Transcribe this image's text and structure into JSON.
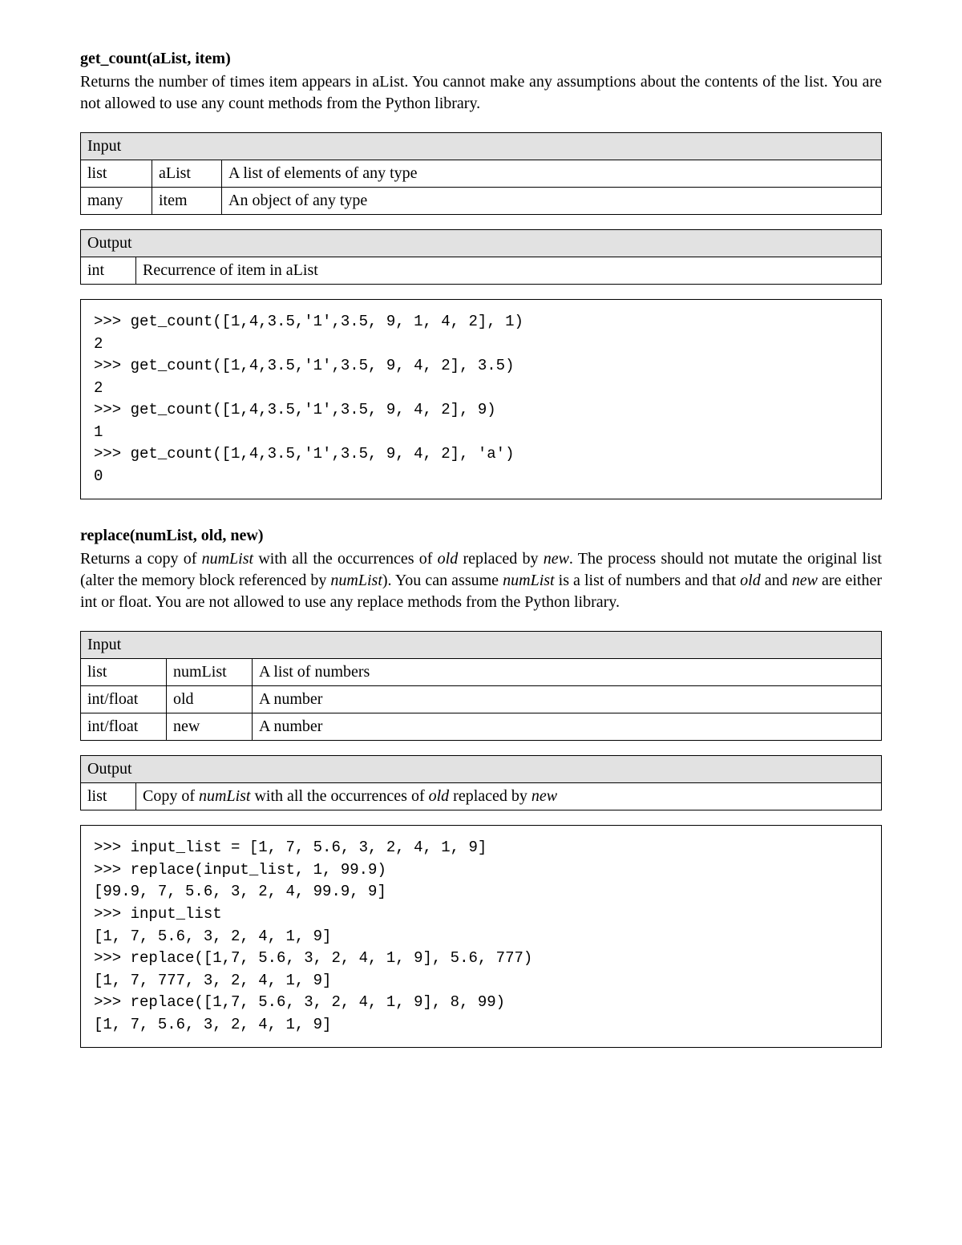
{
  "section1": {
    "heading": "get_count(aList, item)",
    "desc": "Returns the number of times item appears in aList. You cannot make any assumptions about the contents of the list. You are not allowed to use any count methods from the Python library.",
    "input_header": "Input",
    "input_rows": [
      {
        "type": "list",
        "name": "aList",
        "desc": "A list of elements of any type"
      },
      {
        "type": "many",
        "name": "item",
        "desc": "An object of any type"
      }
    ],
    "output_header": "Output",
    "output_rows": [
      {
        "type": "int",
        "desc": "Recurrence of item in aList"
      }
    ],
    "code": ">>> get_count([1,4,3.5,'1',3.5, 9, 1, 4, 2], 1)\n2\n>>> get_count([1,4,3.5,'1',3.5, 9, 4, 2], 3.5)\n2\n>>> get_count([1,4,3.5,'1',3.5, 9, 4, 2], 9)\n1\n>>> get_count([1,4,3.5,'1',3.5, 9, 4, 2], 'a')\n0"
  },
  "section2": {
    "heading": "replace(numList, old, new)",
    "desc_pre": "Returns a copy of ",
    "desc_numList": "numList",
    "desc_mid1": " with all the occurrences of ",
    "desc_old": "old",
    "desc_mid2": " replaced by ",
    "desc_new": "new",
    "desc_mid3": ". The process should not mutate the original list (alter the memory block referenced by ",
    "desc_mid4": "). You can assume ",
    "desc_mid5": " is a list of numbers and that ",
    "desc_mid6": " and ",
    "desc_mid7": " are either int or float. You are not allowed to use any replace methods from the Python library.",
    "input_header": "Input",
    "input_rows": [
      {
        "type": "list",
        "name": "numList",
        "desc": "A list of numbers"
      },
      {
        "type": "int/float",
        "name": "old",
        "desc": "A number"
      },
      {
        "type": "int/float",
        "name": "new",
        "desc": "A number"
      }
    ],
    "output_header": "Output",
    "output_rows": [
      {
        "type": "list",
        "desc_pre": "Copy of ",
        "desc_mid1": " with all the occurrences of ",
        "desc_mid2": " replaced by "
      }
    ],
    "code": ">>> input_list = [1, 7, 5.6, 3, 2, 4, 1, 9]\n>>> replace(input_list, 1, 99.9)\n[99.9, 7, 5.6, 3, 2, 4, 99.9, 9]\n>>> input_list\n[1, 7, 5.6, 3, 2, 4, 1, 9]\n>>> replace([1,7, 5.6, 3, 2, 4, 1, 9], 5.6, 777)\n[1, 7, 777, 3, 2, 4, 1, 9]\n>>> replace([1,7, 5.6, 3, 2, 4, 1, 9], 8, 99)\n[1, 7, 5.6, 3, 2, 4, 1, 9]"
  }
}
